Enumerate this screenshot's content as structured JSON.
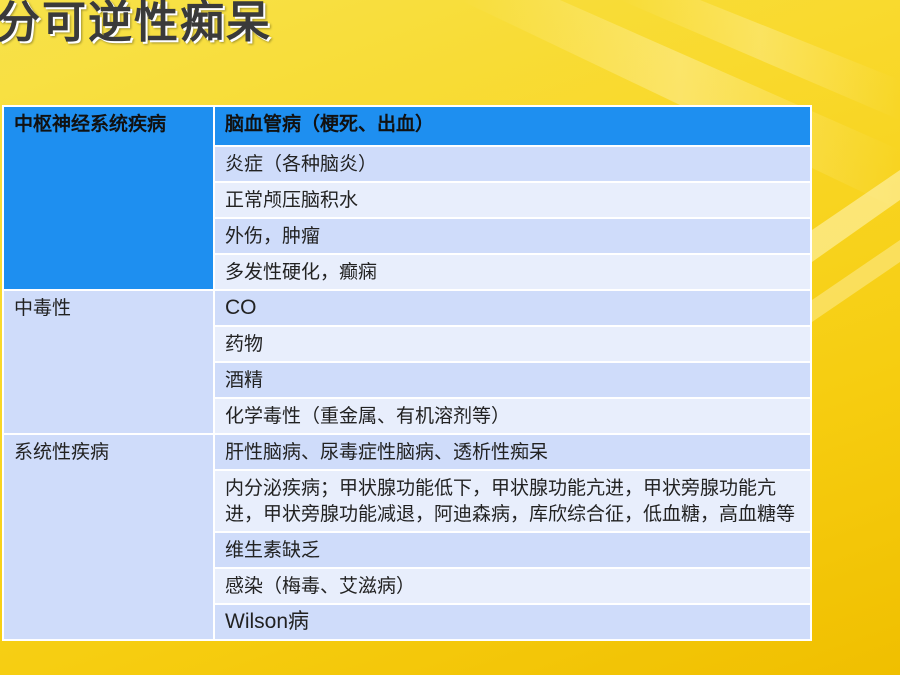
{
  "title": "分可逆性痴呆",
  "table": {
    "groups": [
      {
        "category": "中枢神经系统疾病",
        "items": [
          "脑血管病（梗死、出血）",
          "炎症（各种脑炎）",
          "正常颅压脑积水",
          "外伤，肿瘤",
          "多发性硬化，癫痫"
        ]
      },
      {
        "category": "中毒性",
        "items": [
          "CO",
          "药物",
          "酒精",
          "化学毒性（重金属、有机溶剂等）"
        ]
      },
      {
        "category": "系统性疾病",
        "items": [
          "肝性脑病、尿毒症性脑病、透析性痴呆",
          "内分泌疾病；甲状腺功能低下，甲状腺功能亢进，甲状旁腺功能亢进，甲状旁腺功能减退，阿迪森病，库欣综合征，低血糖，高血糖等",
          "维生素缺乏",
          "感染（梅毒、艾滋病）",
          "Wilson病"
        ]
      }
    ]
  },
  "colors": {
    "background": "#f9d92c",
    "header": "#1e8ff0",
    "row_dark": "#cfdcfa",
    "row_light": "#e8eefc"
  }
}
